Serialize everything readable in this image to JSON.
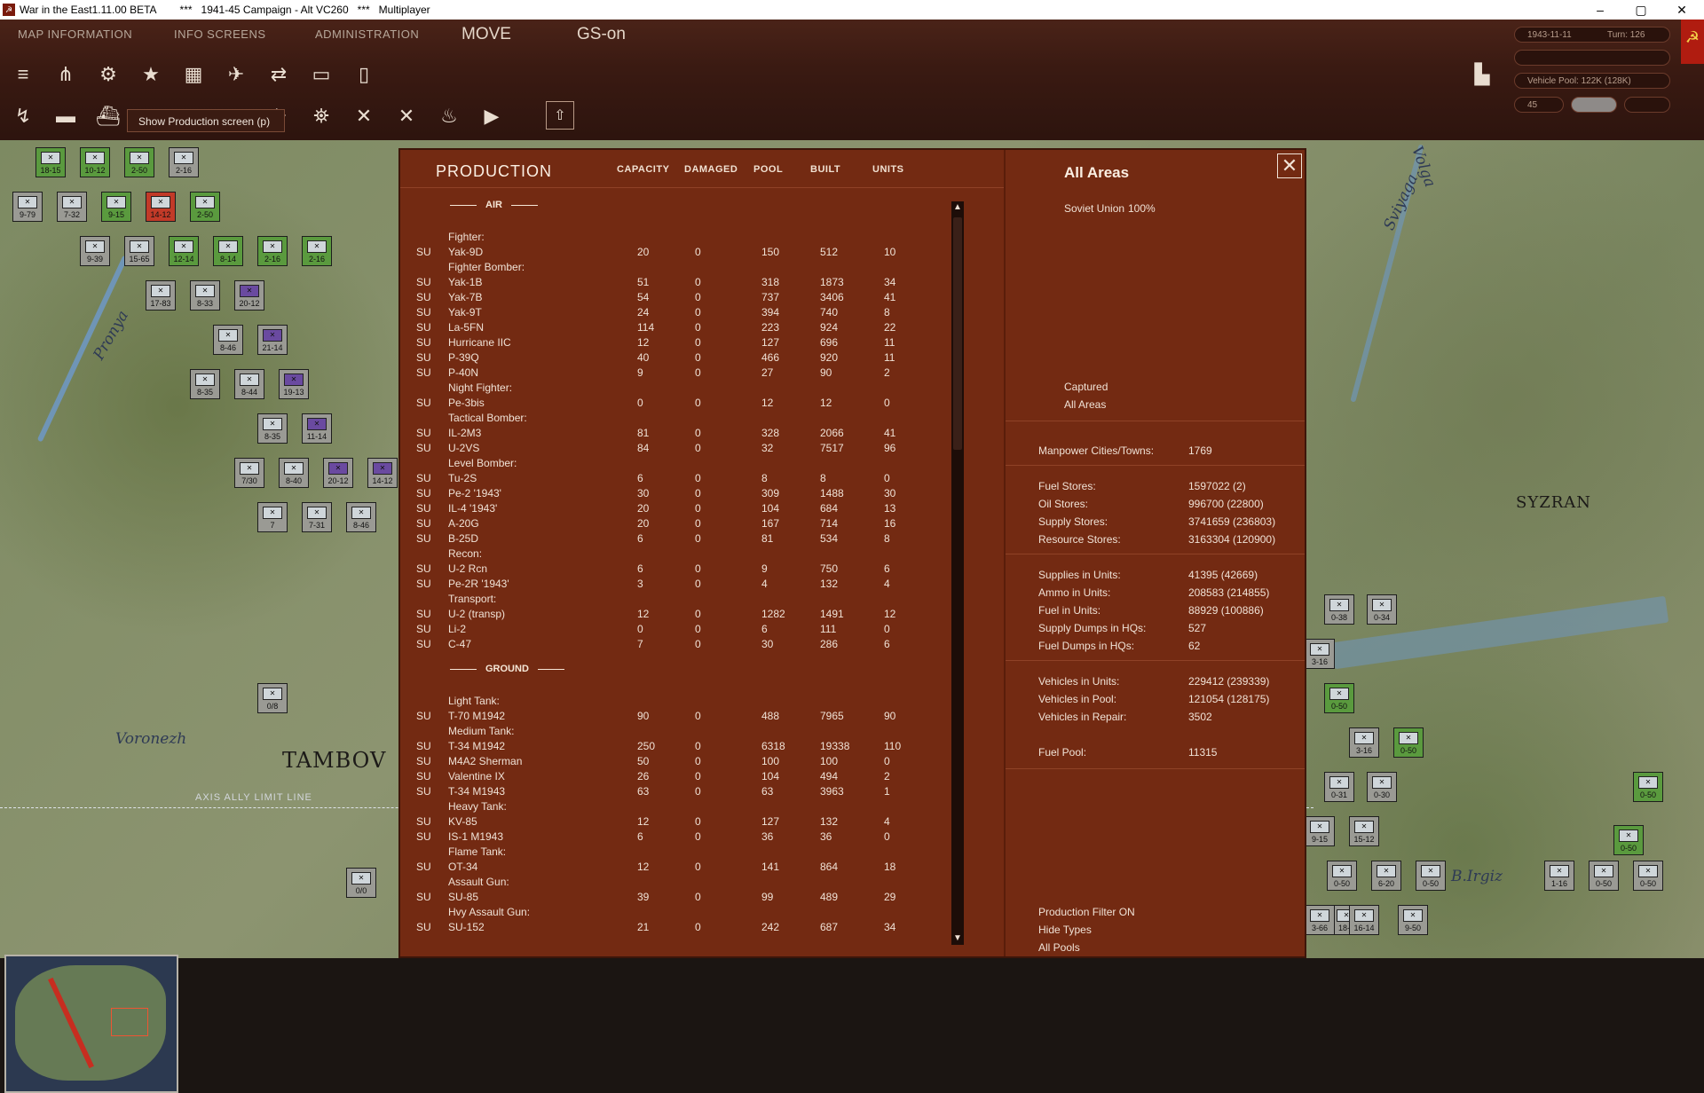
{
  "window": {
    "title": "War in the East1.11.00 BETA        ***   1941-45 Campaign - Alt VC260   ***   Multiplayer",
    "controls": [
      "–",
      "▢",
      "✕"
    ]
  },
  "menu": {
    "tabs": [
      "MAP INFORMATION",
      "INFO SCREENS",
      "ADMINISTRATION"
    ],
    "mode": "MOVE",
    "gs": "GS-on"
  },
  "hud": {
    "date": "1943-11-11",
    "turn": "Turn: 126",
    "vehicle_pool": "Vehicle Pool: 122K (128K)",
    "value45": "45"
  },
  "tooltip": "Show Production screen (p)",
  "map": {
    "places": [
      "Pronya",
      "Voronezh",
      "Volga",
      "Sviyaga",
      "B.Irgiz"
    ],
    "cities": [
      "TAMBOV",
      "SYZRAN"
    ],
    "limit_line": "AXIS ALLY LIMIT LINE",
    "units": [
      "18-15",
      "10-12",
      "2-50",
      "2-16",
      "9-79",
      "7-32",
      "9-15",
      "14-12",
      "2-50",
      "9-39",
      "15-65",
      "12-14",
      "8-14",
      "2-16",
      "2-16",
      "17-83",
      "8-33",
      "20-12",
      "8-46",
      "21-14",
      "8-35",
      "8-44",
      "19-13",
      "8-35",
      "11-14",
      "7/30",
      "8-40",
      "20-12",
      "14-12",
      "7",
      "7-31",
      "8-46",
      "0/8",
      "0/0",
      "0-38",
      "0-34",
      "3-16",
      "0-50",
      "3-16",
      "0-50",
      "0-31",
      "0-30",
      "0-50",
      "9-15",
      "15-12",
      "0-50",
      "1-16",
      "0-50",
      "0-50",
      "6-20",
      "0-50",
      "0-50",
      "18-2",
      "9-50",
      "16-14",
      "3-66"
    ]
  },
  "production": {
    "title": "PRODUCTION",
    "columns": [
      "CAPACITY",
      "DAMAGED",
      "POOL",
      "BUILT",
      "UNITS"
    ],
    "rows": [
      {
        "kind": "section",
        "label": "AIR"
      },
      {
        "kind": "cat",
        "label": "Fighter:"
      },
      {
        "kind": "item",
        "nat": "SU",
        "name": "Yak-9D",
        "cap": "20",
        "dmg": "0",
        "pool": "150",
        "built": "512",
        "units": "10"
      },
      {
        "kind": "cat",
        "label": "Fighter Bomber:"
      },
      {
        "kind": "item",
        "nat": "SU",
        "name": "Yak-1B",
        "cap": "51",
        "dmg": "0",
        "pool": "318",
        "built": "1873",
        "units": "34"
      },
      {
        "kind": "item",
        "nat": "SU",
        "name": "Yak-7B",
        "cap": "54",
        "dmg": "0",
        "pool": "737",
        "built": "3406",
        "units": "41"
      },
      {
        "kind": "item",
        "nat": "SU",
        "name": "Yak-9T",
        "cap": "24",
        "dmg": "0",
        "pool": "394",
        "built": "740",
        "units": "8"
      },
      {
        "kind": "item",
        "nat": "SU",
        "name": "La-5FN",
        "cap": "114",
        "dmg": "0",
        "pool": "223",
        "built": "924",
        "units": "22"
      },
      {
        "kind": "item",
        "nat": "SU",
        "name": "Hurricane IIC",
        "cap": "12",
        "dmg": "0",
        "pool": "127",
        "built": "696",
        "units": "11"
      },
      {
        "kind": "item",
        "nat": "SU",
        "name": "P-39Q",
        "cap": "40",
        "dmg": "0",
        "pool": "466",
        "built": "920",
        "units": "11"
      },
      {
        "kind": "item",
        "nat": "SU",
        "name": "P-40N",
        "cap": "9",
        "dmg": "0",
        "pool": "27",
        "built": "90",
        "units": "2"
      },
      {
        "kind": "cat",
        "label": "Night Fighter:"
      },
      {
        "kind": "item",
        "nat": "SU",
        "name": "Pe-3bis",
        "cap": "0",
        "dmg": "0",
        "pool": "12",
        "built": "12",
        "units": "0"
      },
      {
        "kind": "cat",
        "label": "Tactical Bomber:"
      },
      {
        "kind": "item",
        "nat": "SU",
        "name": "IL-2M3",
        "cap": "81",
        "dmg": "0",
        "pool": "328",
        "built": "2066",
        "units": "41"
      },
      {
        "kind": "item",
        "nat": "SU",
        "name": "U-2VS",
        "cap": "84",
        "dmg": "0",
        "pool": "32",
        "built": "7517",
        "units": "96"
      },
      {
        "kind": "cat",
        "label": "Level Bomber:"
      },
      {
        "kind": "item",
        "nat": "SU",
        "name": "Tu-2S",
        "cap": "6",
        "dmg": "0",
        "pool": "8",
        "built": "8",
        "units": "0"
      },
      {
        "kind": "item",
        "nat": "SU",
        "name": "Pe-2 '1943'",
        "cap": "30",
        "dmg": "0",
        "pool": "309",
        "built": "1488",
        "units": "30"
      },
      {
        "kind": "item",
        "nat": "SU",
        "name": "IL-4 '1943'",
        "cap": "20",
        "dmg": "0",
        "pool": "104",
        "built": "684",
        "units": "13"
      },
      {
        "kind": "item",
        "nat": "SU",
        "name": "A-20G",
        "cap": "20",
        "dmg": "0",
        "pool": "167",
        "built": "714",
        "units": "16"
      },
      {
        "kind": "item",
        "nat": "SU",
        "name": "B-25D",
        "cap": "6",
        "dmg": "0",
        "pool": "81",
        "built": "534",
        "units": "8"
      },
      {
        "kind": "cat",
        "label": "Recon:"
      },
      {
        "kind": "item",
        "nat": "SU",
        "name": "U-2 Rcn",
        "cap": "6",
        "dmg": "0",
        "pool": "9",
        "built": "750",
        "units": "6"
      },
      {
        "kind": "item",
        "nat": "SU",
        "name": "Pe-2R '1943'",
        "cap": "3",
        "dmg": "0",
        "pool": "4",
        "built": "132",
        "units": "4"
      },
      {
        "kind": "cat",
        "label": "Transport:"
      },
      {
        "kind": "item",
        "nat": "SU",
        "name": "U-2 (transp)",
        "cap": "12",
        "dmg": "0",
        "pool": "1282",
        "built": "1491",
        "units": "12"
      },
      {
        "kind": "item",
        "nat": "SU",
        "name": "Li-2",
        "cap": "0",
        "dmg": "0",
        "pool": "6",
        "built": "111",
        "units": "0"
      },
      {
        "kind": "item",
        "nat": "SU",
        "name": "C-47",
        "cap": "7",
        "dmg": "0",
        "pool": "30",
        "built": "286",
        "units": "6"
      },
      {
        "kind": "section",
        "label": "GROUND"
      },
      {
        "kind": "cat",
        "label": "Light Tank:"
      },
      {
        "kind": "item",
        "nat": "SU",
        "name": "T-70 M1942",
        "cap": "90",
        "dmg": "0",
        "pool": "488",
        "built": "7965",
        "units": "90"
      },
      {
        "kind": "cat",
        "label": "Medium Tank:"
      },
      {
        "kind": "item",
        "nat": "SU",
        "name": "T-34 M1942",
        "cap": "250",
        "dmg": "0",
        "pool": "6318",
        "built": "19338",
        "units": "110"
      },
      {
        "kind": "item",
        "nat": "SU",
        "name": "M4A2 Sherman",
        "cap": "50",
        "dmg": "0",
        "pool": "100",
        "built": "100",
        "units": "0"
      },
      {
        "kind": "item",
        "nat": "SU",
        "name": "Valentine IX",
        "cap": "26",
        "dmg": "0",
        "pool": "104",
        "built": "494",
        "units": "2"
      },
      {
        "kind": "item",
        "nat": "SU",
        "name": "T-34 M1943",
        "cap": "63",
        "dmg": "0",
        "pool": "63",
        "built": "3963",
        "units": "1"
      },
      {
        "kind": "cat",
        "label": "Heavy Tank:"
      },
      {
        "kind": "item",
        "nat": "SU",
        "name": "KV-85",
        "cap": "12",
        "dmg": "0",
        "pool": "127",
        "built": "132",
        "units": "4"
      },
      {
        "kind": "item",
        "nat": "SU",
        "name": "IS-1 M1943",
        "cap": "6",
        "dmg": "0",
        "pool": "36",
        "built": "36",
        "units": "0"
      },
      {
        "kind": "cat",
        "label": "Flame Tank:"
      },
      {
        "kind": "item",
        "nat": "SU",
        "name": "OT-34",
        "cap": "12",
        "dmg": "0",
        "pool": "141",
        "built": "864",
        "units": "18"
      },
      {
        "kind": "cat",
        "label": "Assault Gun:"
      },
      {
        "kind": "item",
        "nat": "SU",
        "name": "SU-85",
        "cap": "39",
        "dmg": "0",
        "pool": "99",
        "built": "489",
        "units": "29"
      },
      {
        "kind": "cat",
        "label": "Hvy Assault Gun:"
      },
      {
        "kind": "item",
        "nat": "SU",
        "name": "SU-152",
        "cap": "21",
        "dmg": "0",
        "pool": "242",
        "built": "687",
        "units": "34"
      }
    ]
  },
  "areas": {
    "title": "All Areas",
    "nation": "Soviet Union",
    "pct": "100%",
    "captured": "Captured",
    "captured_sub": "All Areas",
    "manpower_label": "Manpower Cities/Towns:",
    "manpower": "1769",
    "stores": [
      {
        "label": "Fuel Stores:",
        "value": "1597022 (2)"
      },
      {
        "label": "Oil Stores:",
        "value": "996700 (22800)"
      },
      {
        "label": "Supply Stores:",
        "value": "3741659 (236803)"
      },
      {
        "label": "Resource Stores:",
        "value": "3163304 (120900)"
      }
    ],
    "units": [
      {
        "label": "Supplies in Units:",
        "value": "41395 (42669)"
      },
      {
        "label": "Ammo in Units:",
        "value": "208583 (214855)"
      },
      {
        "label": "Fuel in Units:",
        "value": "88929 (100886)"
      },
      {
        "label": "Supply Dumps in HQs:",
        "value": "527"
      },
      {
        "label": "Fuel Dumps in HQs:",
        "value": "62"
      }
    ],
    "vehicles": [
      {
        "label": "Vehicles in Units:",
        "value": "229412 (239339)"
      },
      {
        "label": "Vehicles in Pool:",
        "value": "121054 (128175)"
      },
      {
        "label": "Vehicles in Repair:",
        "value": "3502"
      }
    ],
    "fuel_pool_label": "Fuel Pool:",
    "fuel_pool": "11315",
    "filters": [
      "Production Filter ON",
      "Hide Types",
      "All Pools"
    ]
  }
}
